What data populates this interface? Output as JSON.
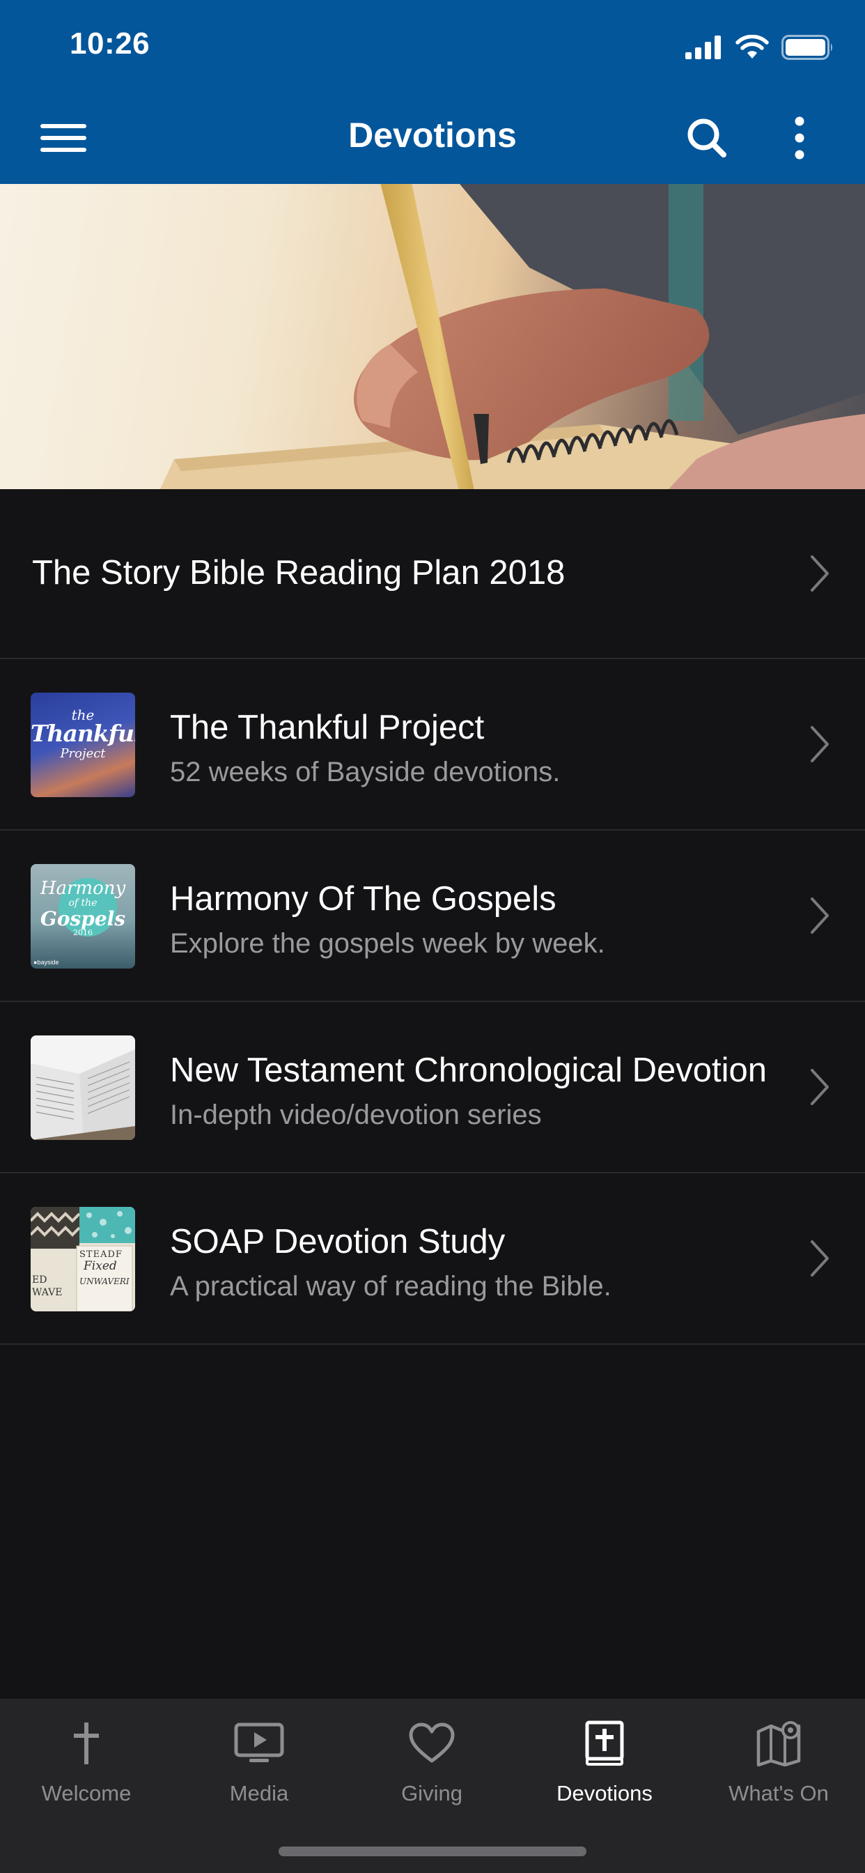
{
  "status": {
    "time": "10:26"
  },
  "appbar": {
    "title": "Devotions",
    "menu_icon": "hamburger-icon",
    "search_icon": "search-icon",
    "more_icon": "more-vertical-icon"
  },
  "featured": {
    "title": "The Story Bible Reading Plan 2018"
  },
  "items": [
    {
      "title": "The Thankful Project",
      "subtitle": "52 weeks of Bayside devotions."
    },
    {
      "title": "Harmony Of The Gospels",
      "subtitle": "Explore the gospels week by week."
    },
    {
      "title": "New Testament Chronological Devotion",
      "subtitle": "In-depth video/devotion series"
    },
    {
      "title": "SOAP Devotion Study",
      "subtitle": "A practical way of reading the Bible."
    }
  ],
  "thumbs": {
    "thankful": {
      "line1": "the",
      "line2": "Thankful",
      "line3": "Project"
    },
    "harmony": {
      "line1": "Harmony",
      "line2": "of the",
      "line3": "Gospels",
      "line4": "2016",
      "brand": "●bayside"
    },
    "soap": {
      "line1": "STEADF",
      "line2": "Fixed",
      "line3": "UNWAVERI",
      "line4": "ED",
      "line5": "WAVE"
    }
  },
  "tabs": [
    {
      "label": "Welcome",
      "icon": "cross-icon"
    },
    {
      "label": "Media",
      "icon": "play-screen-icon"
    },
    {
      "label": "Giving",
      "icon": "heart-icon"
    },
    {
      "label": "Devotions",
      "icon": "bible-icon",
      "active": true
    },
    {
      "label": "What's On",
      "icon": "map-pin-icon"
    }
  ],
  "colors": {
    "app_bar": "#04569b",
    "background": "#131315",
    "divider": "#2a2a2e",
    "nav_bg": "#252527",
    "subtitle": "#9a9a9e"
  }
}
